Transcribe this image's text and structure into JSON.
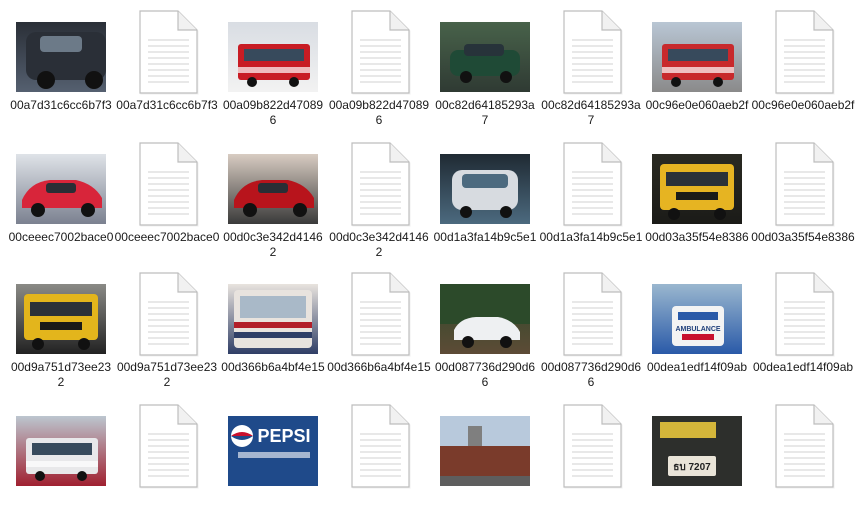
{
  "files": [
    {
      "name": "00a7d31c6cc6b7f3",
      "type": "image",
      "icon": "photo-dark-car-icon",
      "colors": [
        "#2a2f37",
        "#8f8f87",
        "#556070"
      ]
    },
    {
      "name": "00a7d31c6cc6b7f3",
      "type": "document",
      "icon": "document-icon"
    },
    {
      "name": "00a09b822d470896",
      "type": "image",
      "icon": "photo-red-white-bus-icon",
      "colors": [
        "#d9dde3",
        "#c81c24",
        "#f2f2f2"
      ]
    },
    {
      "name": "00a09b822d470896",
      "type": "document",
      "icon": "document-icon"
    },
    {
      "name": "00c82d64185293a7",
      "type": "image",
      "icon": "photo-green-car-icon",
      "colors": [
        "#48624a",
        "#1f4a36",
        "#2f3a33"
      ]
    },
    {
      "name": "00c82d64185293a7",
      "type": "document",
      "icon": "document-icon"
    },
    {
      "name": "00c96e0e060aeb2f",
      "type": "image",
      "icon": "photo-red-bus-icon",
      "colors": [
        "#b9c6d4",
        "#c8292c",
        "#8a8a8a"
      ]
    },
    {
      "name": "00c96e0e060aeb2f",
      "type": "document",
      "icon": "document-icon"
    },
    {
      "name": "00ceeec7002bace0",
      "type": "image",
      "icon": "photo-red-hatchback-icon",
      "colors": [
        "#dfe3e8",
        "#d8253a",
        "#7b8190"
      ]
    },
    {
      "name": "00ceeec7002bace0",
      "type": "document",
      "icon": "document-icon"
    },
    {
      "name": "00d0c3e342d41462",
      "type": "image",
      "icon": "photo-red-sports-car-icon",
      "colors": [
        "#d8ccc2",
        "#b8141c",
        "#3a3a3a"
      ]
    },
    {
      "name": "00d0c3e342d41462",
      "type": "document",
      "icon": "document-icon"
    },
    {
      "name": "00d1a3fa14b9c5e1",
      "type": "image",
      "icon": "photo-silver-van-icon",
      "colors": [
        "#1f2a33",
        "#d7dbe0",
        "#4c6a7f"
      ]
    },
    {
      "name": "00d1a3fa14b9c5e1",
      "type": "document",
      "icon": "document-icon"
    },
    {
      "name": "00d03a35f54e8386",
      "type": "image",
      "icon": "photo-yellow-bus-icon",
      "colors": [
        "#2a2a22",
        "#e6b422",
        "#1b1b18"
      ]
    },
    {
      "name": "00d03a35f54e8386",
      "type": "document",
      "icon": "document-icon"
    },
    {
      "name": "00d9a751d73ee232",
      "type": "image",
      "icon": "photo-yellow-school-bus-icon",
      "colors": [
        "#8a8a86",
        "#e3b51c",
        "#222222"
      ]
    },
    {
      "name": "00d9a751d73ee232",
      "type": "document",
      "icon": "document-icon"
    },
    {
      "name": "00d366b6a4bf4e15",
      "type": "image",
      "icon": "photo-vintage-bus-icon",
      "colors": [
        "#e8e3de",
        "#b21f2a",
        "#2f3e66"
      ]
    },
    {
      "name": "00d366b6a4bf4e15",
      "type": "document",
      "icon": "document-icon"
    },
    {
      "name": "00d087736d290d66",
      "type": "image",
      "icon": "photo-white-car-forest-icon",
      "colors": [
        "#2c4a2a",
        "#eef0f2",
        "#5d4b36"
      ]
    },
    {
      "name": "00d087736d290d66",
      "type": "document",
      "icon": "document-icon"
    },
    {
      "name": "00dea1edf14f09ab",
      "type": "image",
      "icon": "photo-ambulance-icon",
      "colors": [
        "#9ab7cf",
        "#f3f3f3",
        "#2a5aa8"
      ]
    },
    {
      "name": "00dea1edf14f09ab",
      "type": "document",
      "icon": "document-icon"
    },
    {
      "name": "",
      "type": "image",
      "icon": "photo-bus-street-icon",
      "colors": [
        "#bcc6cf",
        "#e8e8ea",
        "#a02030"
      ]
    },
    {
      "name": "",
      "type": "document",
      "icon": "document-icon"
    },
    {
      "name": "",
      "type": "image",
      "icon": "photo-pepsi-sign-icon",
      "colors": [
        "#1f4a8a",
        "#f2f2f2",
        "#c8102e"
      ]
    },
    {
      "name": "",
      "type": "document",
      "icon": "document-icon"
    },
    {
      "name": "",
      "type": "image",
      "icon": "photo-brick-street-icon",
      "colors": [
        "#b8c9dc",
        "#7a3b2b",
        "#5e5e5e"
      ]
    },
    {
      "name": "",
      "type": "document",
      "icon": "document-icon"
    },
    {
      "name": "",
      "type": "image",
      "icon": "photo-license-plate-icon",
      "colors": [
        "#2d2f2c",
        "#d3b53a",
        "#e9e4d8"
      ]
    },
    {
      "name": "",
      "type": "document",
      "icon": "document-icon"
    }
  ],
  "overlay": {
    "pepsi_text": "PEPSI",
    "plate_text": "ธบ 7207",
    "ambulance_text": "AMBULANCE"
  }
}
